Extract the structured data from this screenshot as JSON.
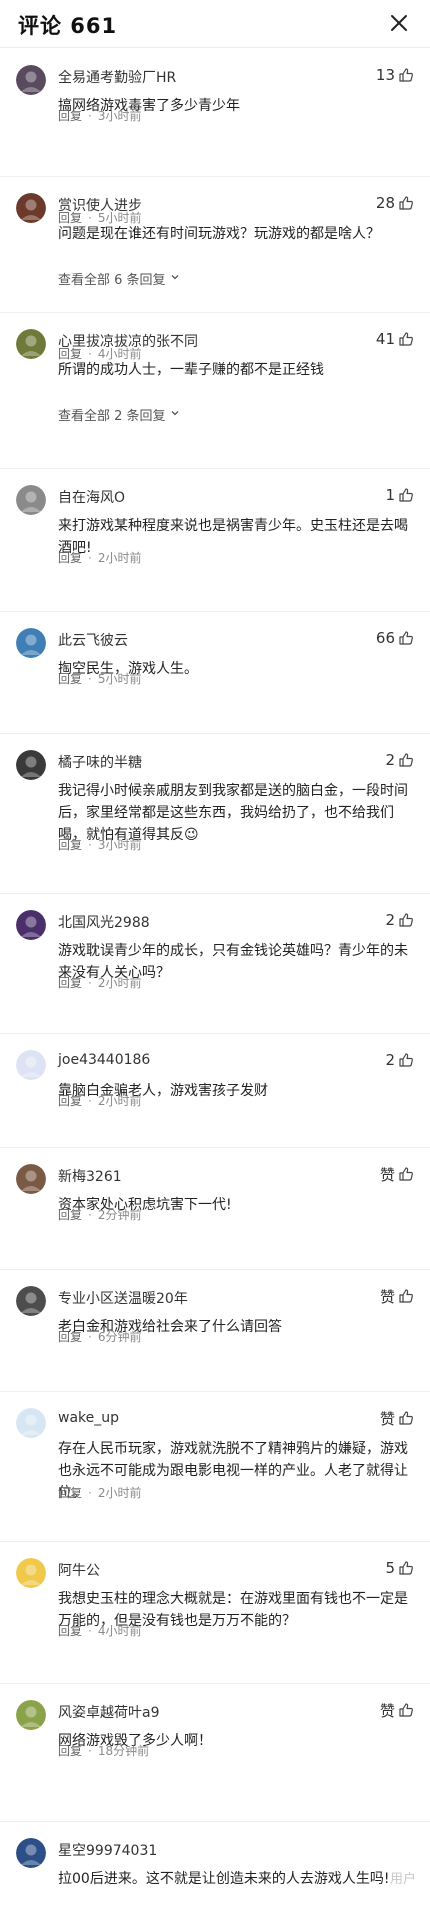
{
  "header": {
    "title": "评论 661"
  },
  "labels": {
    "reply": "回复",
    "dot": "·"
  },
  "comments": [
    {
      "user": "全易通考勤验厂HR",
      "likes": "13",
      "text": "搞网络游戏毒害了多少青少年",
      "time": "3小时前",
      "replies": "",
      "avatar_color": "#5a4a5e"
    },
    {
      "user": "赏识使人进步",
      "likes": "28",
      "text": "问题是现在谁还有时间玩游戏？玩游戏的都是啥人？",
      "time": "5小时前",
      "replies": "查看全部 6 条回复",
      "avatar_color": "#6b3a2a"
    },
    {
      "user": "心里拔凉拔凉的张不同",
      "likes": "41",
      "text": "所谓的成功人士，一辈子赚的都不是正经钱",
      "time": "4小时前",
      "replies": "查看全部 2 条回复",
      "avatar_color": "#6f7a3a"
    },
    {
      "user": "自在海风O",
      "likes": "1",
      "text": "来打游戏某种程度来说也是祸害青少年。史玉柱还是去喝酒吧!",
      "time": "2小时前",
      "replies": "",
      "avatar_color": "#8a8a8a"
    },
    {
      "user": "此云飞彼云",
      "likes": "66",
      "text": "掏空民生，游戏人生。",
      "time": "5小时前",
      "replies": "",
      "avatar_color": "#3f7fb5"
    },
    {
      "user": "橘子味的半糖",
      "likes": "2",
      "text": "我记得小时候亲戚朋友到我家都是送的脑白金，一段时间后，家里经常都是这些东西，我妈给扔了，也不给我们喝，就怕有道得其反😉",
      "time": "3小时前",
      "replies": "",
      "avatar_color": "#3a3a3a"
    },
    {
      "user": "北国风光2988",
      "likes": "2",
      "text": "游戏耽误青少年的成长，只有金钱论英雄吗？青少年的未来没有人关心吗？",
      "time": "2小时前",
      "replies": "",
      "avatar_color": "#4a2f6b"
    },
    {
      "user": "joe43440186",
      "likes": "2",
      "text": "靠脑白金骗老人，游戏害孩子发财",
      "time": "2小时前",
      "replies": "",
      "avatar_color": "#dde3f5"
    },
    {
      "user": "新梅3261",
      "likes": "赞",
      "text": "资本家处心积虑坑害下一代!",
      "time": "2分钟前",
      "replies": "",
      "avatar_color": "#7a5a45"
    },
    {
      "user": "专业小区送温暖20年",
      "likes": "赞",
      "text": "老白金和游戏给社会来了什么请回答",
      "time": "6分钟前",
      "replies": "",
      "avatar_color": "#4d4d4d"
    },
    {
      "user": "wake_up",
      "likes": "赞",
      "text": "存在人民币玩家，游戏就洗脱不了精神鸦片的嫌疑，游戏也永远不可能成为跟电影电视一样的产业。人老了就得让位。",
      "time": "2小时前",
      "replies": "",
      "avatar_color": "#d7e6f3"
    },
    {
      "user": "阿牛公",
      "likes": "5",
      "text": "我想史玉柱的理念大概就是：在游戏里面有钱也不一定是万能的，但是没有钱也是万万不能的？",
      "time": "4小时前",
      "replies": "",
      "avatar_color": "#f0c84a"
    },
    {
      "user": "风姿卓越荷叶a9",
      "likes": "赞",
      "text": "网络游戏毁了多少人啊！",
      "time": "18分钟前",
      "replies": "",
      "avatar_color": "#8aa24a"
    },
    {
      "user": "星空99974031",
      "likes": "",
      "text": "拉00后进来。这不就是让创造未来的人去游戏人生吗!",
      "time": "",
      "replies": "",
      "avatar_color": "#2b4f86"
    }
  ],
  "watermark": "用户"
}
